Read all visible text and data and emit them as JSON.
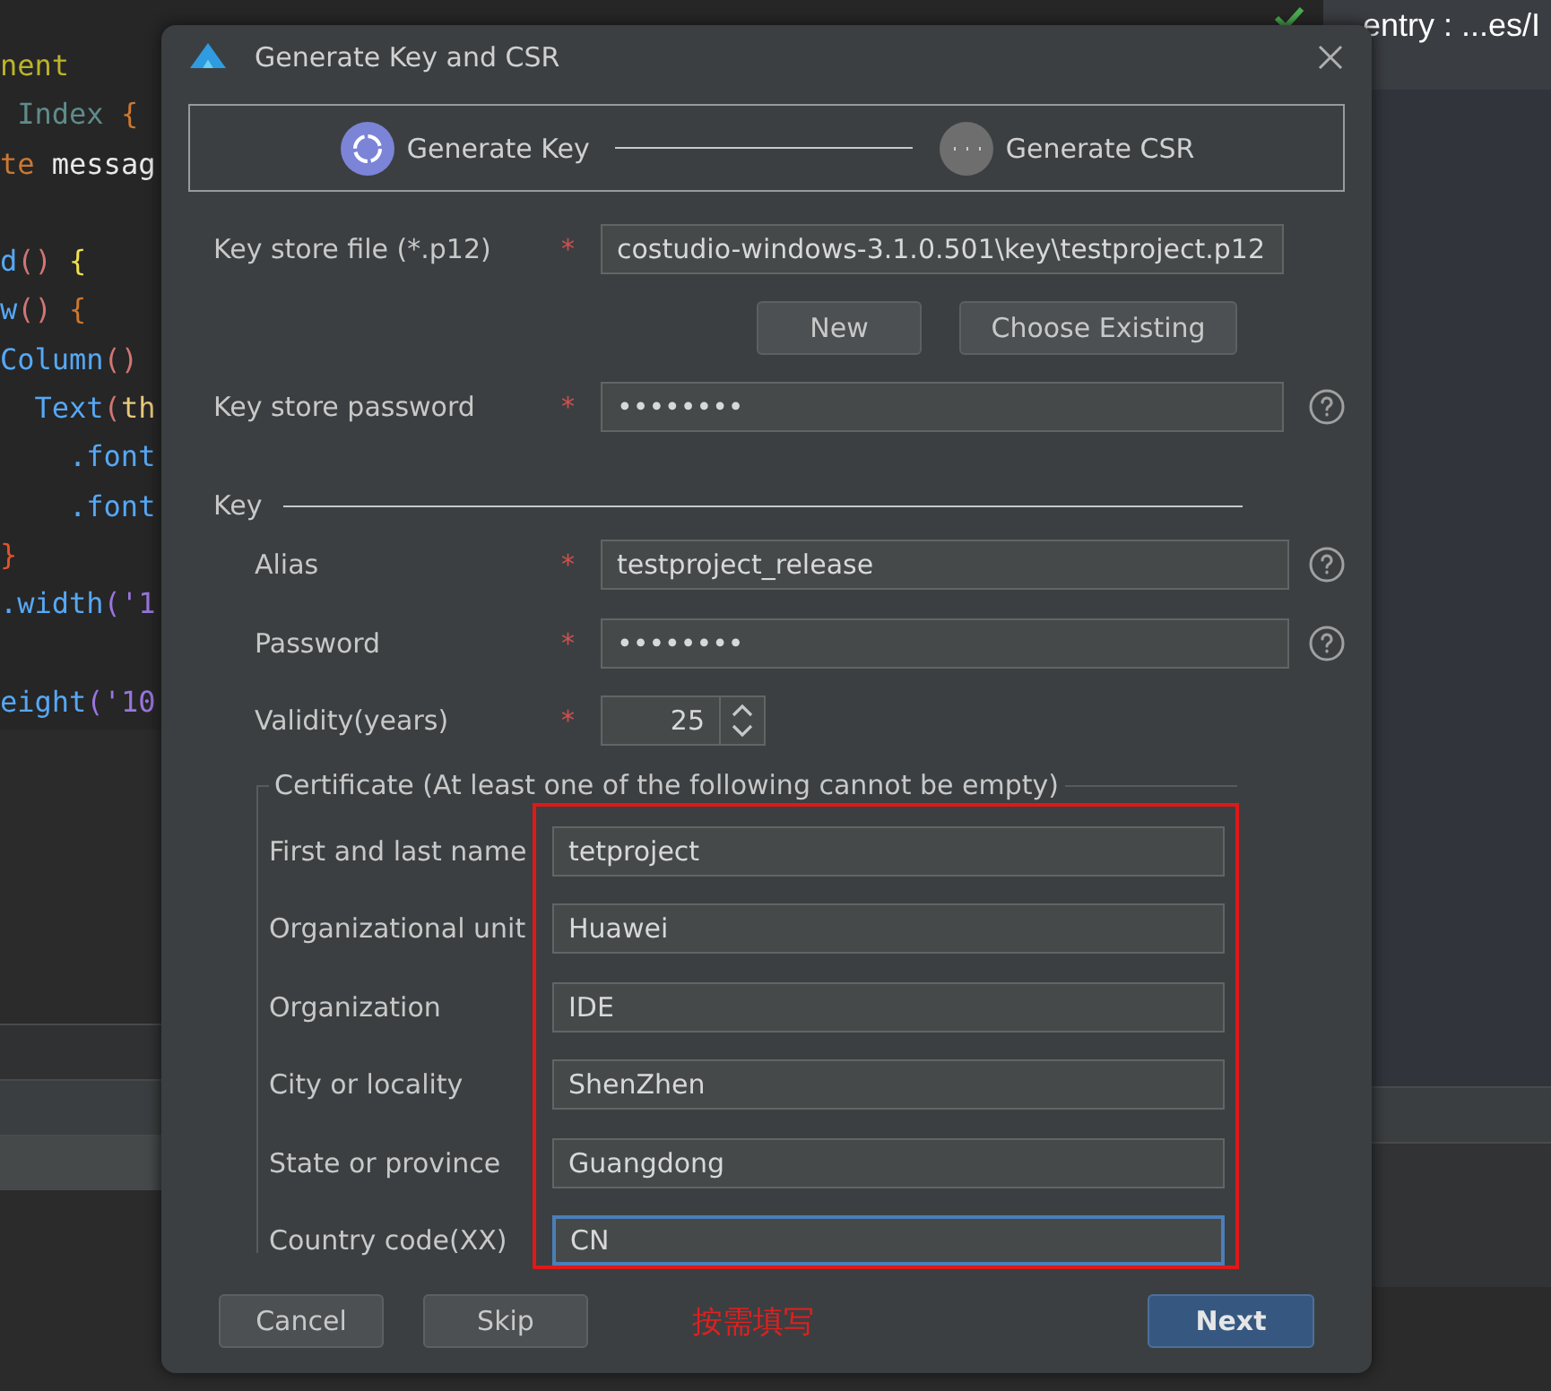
{
  "editor": {
    "lines": [
      {
        "blank_before": false,
        "tokens": [
          {
            "text": "nent",
            "color": "#bbb529"
          }
        ]
      },
      {
        "blank_before": false,
        "tokens": [
          {
            "text": " Index ",
            "color": "#5f8c8a"
          },
          {
            "text": "{",
            "color": "#cc7832"
          }
        ]
      },
      {
        "blank_before": false,
        "tokens": [
          {
            "text": "te ",
            "color": "#cc7832"
          },
          {
            "text": "messag",
            "color": "#e8e8e8"
          }
        ]
      },
      {
        "blank_before": true,
        "tokens": [
          {
            "text": "d",
            "color": "#56a8f5"
          },
          {
            "text": "() ",
            "color": "#d27575"
          },
          {
            "text": "{",
            "color": "#f0e050"
          }
        ]
      },
      {
        "blank_before": false,
        "tokens": [
          {
            "text": "w",
            "color": "#56a8f5"
          },
          {
            "text": "() ",
            "color": "#d27575"
          },
          {
            "text": "{",
            "color": "#cc7832"
          }
        ]
      },
      {
        "blank_before": false,
        "tokens": [
          {
            "text": "Column",
            "color": "#56a8f5"
          },
          {
            "text": "()",
            "color": "#d27575"
          }
        ]
      },
      {
        "blank_before": false,
        "tokens": [
          {
            "text": "  Text",
            "color": "#56a8f5"
          },
          {
            "text": "(",
            "color": "#d27575"
          },
          {
            "text": "th",
            "color": "#e8c87a"
          }
        ]
      },
      {
        "blank_before": false,
        "tokens": [
          {
            "text": "    .font",
            "color": "#56a8f5"
          }
        ]
      },
      {
        "blank_before": false,
        "tokens": [
          {
            "text": "    .font",
            "color": "#56a8f5"
          }
        ]
      },
      {
        "blank_before": false,
        "tokens": [
          {
            "text": "}",
            "color": "#e0542c"
          }
        ]
      },
      {
        "blank_before": false,
        "tokens": [
          {
            "text": ".width",
            "color": "#56a8f5"
          },
          {
            "text": "('1",
            "color": "#9876dd"
          }
        ]
      },
      {
        "blank_before": true,
        "tokens": [
          {
            "text": "eight",
            "color": "#56a8f5"
          },
          {
            "text": "('10",
            "color": "#9876dd"
          }
        ]
      }
    ]
  },
  "side_tab": {
    "title": "entry : ...es/I"
  },
  "dialog": {
    "title": "Generate Key and CSR",
    "steps": [
      {
        "label": "Generate Key",
        "selected": true
      },
      {
        "label": "Generate CSR",
        "selected": false
      }
    ],
    "key_store": [
      {
        "kind": "field",
        "label": "Key store file (*.p12)",
        "required": "*",
        "value": "costudio-windows-3.1.0.501\\key\\testproject.p12",
        "help": false
      },
      {
        "kind": "buttons",
        "buttons": [
          "New",
          "Choose Existing"
        ]
      },
      {
        "kind": "field",
        "label": "Key store password",
        "required": "*",
        "value": "••••••••",
        "help": true
      }
    ],
    "key_section": {
      "title": "Key",
      "rows": [
        {
          "kind": "field",
          "label": "Alias",
          "required": "*",
          "value": "testproject_release",
          "help": true
        },
        {
          "kind": "field",
          "label": "Password",
          "required": "*",
          "value": "••••••••",
          "help": true
        },
        {
          "kind": "spinner",
          "label": "Validity(years)",
          "required": "*",
          "value": "25"
        }
      ]
    },
    "certificate": {
      "title": "Certificate (At least one of the following cannot be empty)",
      "rows": [
        {
          "label": "First and last name",
          "value": "tetproject",
          "focused": false
        },
        {
          "label": "Organizational unit",
          "value": "Huawei",
          "focused": false
        },
        {
          "label": "Organization",
          "value": "IDE",
          "focused": false
        },
        {
          "label": "City or locality",
          "value": "ShenZhen",
          "focused": false
        },
        {
          "label": "State or province",
          "value": "Guangdong",
          "focused": false
        },
        {
          "label": "Country code(XX)",
          "value": "CN",
          "focused": true
        }
      ]
    },
    "annotation": "按需填写",
    "buttons": [
      {
        "label": "Cancel",
        "primary": false
      },
      {
        "label": "Skip",
        "primary": false
      },
      {
        "label": "Next",
        "primary": true
      }
    ]
  }
}
